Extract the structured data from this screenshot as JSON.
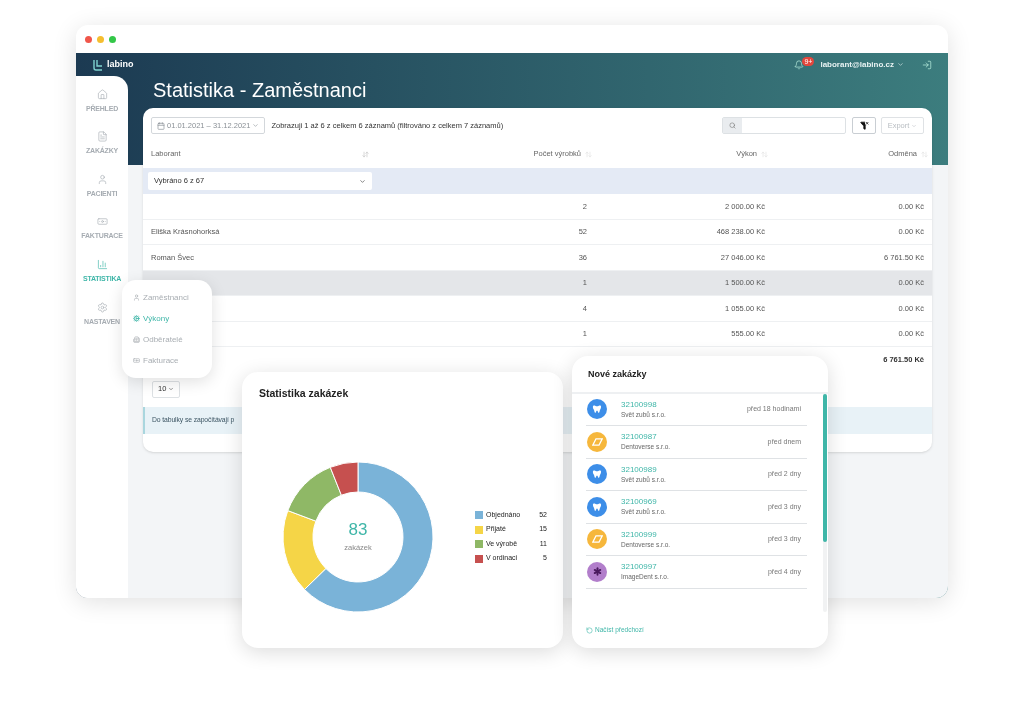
{
  "app": {
    "logo": "labino",
    "notifications_badge": "9+",
    "user": "laborant@labino.cz"
  },
  "sidebar": {
    "items": [
      {
        "kind": "home",
        "label": "PŘEHLED",
        "selected": false
      },
      {
        "kind": "file",
        "label": "ZAKÁZKY",
        "selected": false
      },
      {
        "kind": "user",
        "label": "PACIENTI",
        "selected": false
      },
      {
        "kind": "money",
        "label": "FAKTURACE",
        "selected": false
      },
      {
        "kind": "chart",
        "label": "STATISTIKA",
        "selected": true
      },
      {
        "kind": "settings",
        "label": "NASTAVEN",
        "selected": false
      }
    ]
  },
  "page_title": "Statistika - Zaměstnanci",
  "toolbar": {
    "date_range": "01.01.2021 – 31.12.2021",
    "info": "Zobrazuji 1 až 6 z celkem 6 záznamů (filtrováno z celkem 7 záznamů)",
    "export": {
      "label": "Export",
      "disabled": true
    }
  },
  "table": {
    "columns": [
      "Laborant",
      "Počet výrobků",
      "Výkon",
      "Odměna"
    ],
    "filter": "Vybráno 6 z 67",
    "rows": [
      {
        "count": "2",
        "performance": "2 000.00 Kč",
        "reward": "0.00 Kč",
        "highlighted": false
      },
      {
        "name": "Eliška Krásnohorksá",
        "count": "52",
        "performance": "468 238.00 Kč",
        "reward": "0.00 Kč",
        "highlighted": false
      },
      {
        "name": "Roman Švec",
        "count": "36",
        "performance": "27 046.00 Kč",
        "reward": "6 761.50 Kč",
        "highlighted": false
      },
      {
        "count": "1",
        "performance": "1 500.00 Kč",
        "reward": "0.00 Kč",
        "highlighted": true
      },
      {
        "count": "4",
        "performance": "1 055.00 Kč",
        "reward": "0.00 Kč",
        "highlighted": false
      },
      {
        "count": "1",
        "performance": "555.00 Kč",
        "reward": "0.00 Kč",
        "highlighted": false
      }
    ],
    "total": {
      "reward": "6 761.50 Kč"
    },
    "page_size": "10",
    "note": "Do tabulky se započítávají p"
  },
  "submenu": {
    "items": [
      {
        "kind": "user",
        "label": "Zaměstnanci",
        "selected": false
      },
      {
        "kind": "gear",
        "label": "Výkony",
        "selected": true
      },
      {
        "kind": "building",
        "label": "Odběratelé",
        "selected": false
      },
      {
        "kind": "money",
        "label": "Fakturace",
        "selected": false
      }
    ]
  },
  "orders_chart": {
    "total": "83",
    "total_label": "zakázek",
    "chart_data": {
      "type": "donut",
      "title": "Statistika zakázek",
      "categories": [
        "Objednáno",
        "Přijaté",
        "Ve výrobě",
        "V ordinaci"
      ],
      "values": [
        52,
        15,
        11,
        5
      ],
      "colors": [
        "#7ab3d8",
        "#f5d547",
        "#8fb866",
        "#c6504f"
      ],
      "legend": "right",
      "value_labels": [
        "52",
        "15",
        "11",
        "5"
      ]
    }
  },
  "new_orders": {
    "title": "Nové zakázky",
    "items": [
      {
        "kind": "tooth",
        "id": "32100998",
        "company": "Svět zubů s.r.o.",
        "time": "před 18 hodinami"
      },
      {
        "kind": "tag",
        "id": "32100987",
        "company": "Dentoverse s.r.o.",
        "time": "před dnem"
      },
      {
        "kind": "tooth",
        "id": "32100989",
        "company": "Svět zubů s.r.o.",
        "time": "před 2 dny"
      },
      {
        "kind": "tooth",
        "id": "32100969",
        "company": "Svět zubů s.r.o.",
        "time": "před 3 dny"
      },
      {
        "kind": "tag",
        "id": "32100999",
        "company": "Dentoverse s.r.o.",
        "time": "před 3 dny"
      },
      {
        "kind": "asterisk",
        "id": "32100997",
        "company": "ImageDent s.r.o.",
        "time": "před 4 dny"
      }
    ],
    "load_more": "Načíst předchozí"
  }
}
